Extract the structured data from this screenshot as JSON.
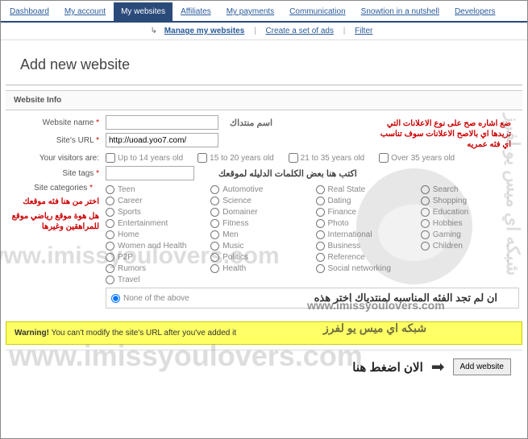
{
  "tabs": [
    "Dashboard",
    "My account",
    "My websites",
    "Affiliates",
    "My payments",
    "Communication",
    "Snowtion in a nutshell",
    "Developers"
  ],
  "activeTab": 2,
  "subnav": {
    "manage": "Manage my websites",
    "create": "Create a set of ads",
    "filter": "Filter"
  },
  "pageTitle": "Add new website",
  "sectionHeader": "Website Info",
  "labels": {
    "websiteName": "Website name",
    "siteUrl": "Site's URL",
    "visitors": "Your visitors are:",
    "siteTags": "Site tags",
    "siteCats": "Site categories",
    "arChoose": "اختر من هنا فئه موقعك",
    "arSports": "هل هوة موقع رياضي موقع للمراهقين وغيرها"
  },
  "inputs": {
    "websiteName": "",
    "websiteNameAnn": "اسم منتداك",
    "siteUrl": "http://uoad.yoo7.com/",
    "siteTags": "",
    "tagsAnn": "اكتب هنا بعض الكلمات الدليله لموقعك"
  },
  "redNote": "ضع اشاره صح على نوع الاعلانات التي تريدها اي بالاصح الاعلانات سوف تناسب اي فئه عمريه",
  "ages": [
    "Up to 14 years old",
    "15 to 20 years old",
    "21 to 35 years old",
    "Over 35 years old"
  ],
  "cats": {
    "c1": [
      "Teen",
      "Career",
      "Sports",
      "Entertainment",
      "Home",
      "Women and Health",
      "P2P",
      "Rumors",
      "Travel"
    ],
    "c2": [
      "Automotive",
      "Science",
      "Domainer",
      "Fitness",
      "Men",
      "Music",
      "Politics",
      "Health"
    ],
    "c3": [
      "Real State",
      "Dating",
      "Finance",
      "Photo",
      "International",
      "Business",
      "Reference",
      "Social networking"
    ],
    "c4": [
      "Search",
      "Shopping",
      "Education",
      "Hobbies",
      "Gaming",
      "Children"
    ]
  },
  "noneLabel": "None of the above",
  "noneAnn": "ان لم تجد الفئه المناسبه لمنتدياك اختر هذه",
  "warning": {
    "title": "Warning!",
    "text": " You can't modify the site's URL after you've added it"
  },
  "addBtn": "Add website",
  "pressAnn": "الان اضغط هنا",
  "watermarks": {
    "url": "www.imissyoulovers.com",
    "brand": "شبكه اي ميس يو لفرز"
  }
}
